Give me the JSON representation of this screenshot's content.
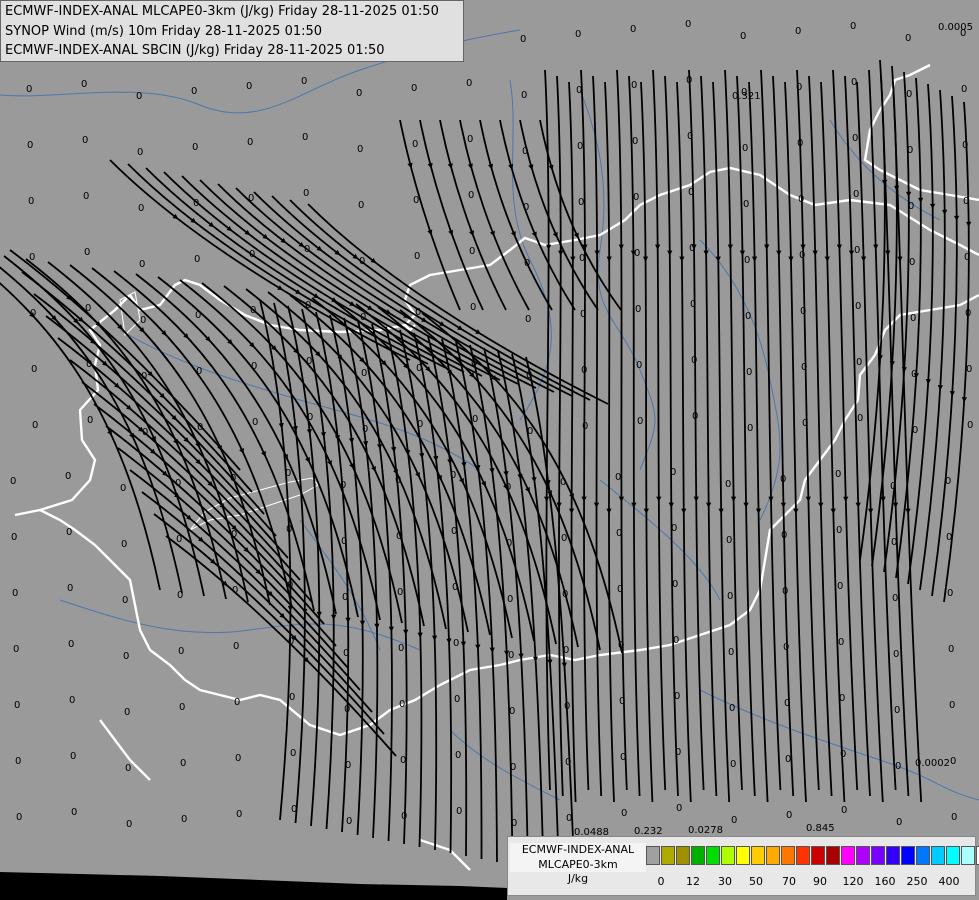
{
  "title_lines": [
    "ECMWF-INDEX-ANAL MLCAPE0-3km (J/kg) Friday 28-11-2025 01:50",
    "SYNOP Wind (m/s) 10m Friday 28-11-2025 01:50",
    "ECMWF-INDEX-ANAL SBCIN (J/kg) Friday 28-11-2025 01:50"
  ],
  "legend": {
    "line1": "ECMWF-INDEX-ANAL",
    "line2": "MLCAPE0-3km",
    "line3": "J/kg",
    "colors": [
      "#a0a0a0",
      "#b0aa00",
      "#a09000",
      "#00b000",
      "#00dd00",
      "#b0ff00",
      "#ffff00",
      "#ffcc00",
      "#ffaa00",
      "#ff7700",
      "#ff3300",
      "#cc0000",
      "#aa0000",
      "#ff00ff",
      "#b000ff",
      "#7700ff",
      "#3300ff",
      "#0000ff",
      "#0077ff",
      "#00ccff",
      "#00ffff",
      "#aaffff",
      "#ffffff"
    ],
    "ticks": [
      "0",
      "12",
      "30",
      "50",
      "70",
      "90",
      "120",
      "160",
      "250",
      "400"
    ]
  },
  "map_values": {
    "zeros_note": "0",
    "special": [
      "0.0005",
      "0.321",
      "0.0488",
      "0.232",
      "0.0278",
      "0.845",
      "0.0002"
    ]
  }
}
